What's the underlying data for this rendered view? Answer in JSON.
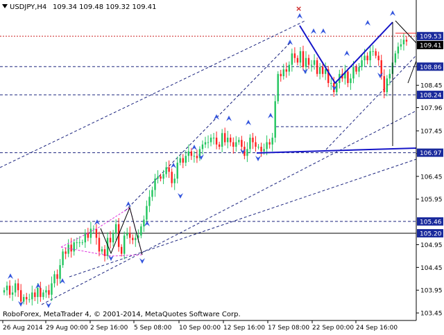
{
  "header": {
    "symbol_timeframe": "USDJPY,H4",
    "ohlc": "109.34 109.48 109.32 109.41",
    "arrow_icon": "triangle-down-icon"
  },
  "watermark": "RoboForex, MetaTrader 4, © 2001-2014, MetaQuotes Software Corp.",
  "colors": {
    "background": "#ffffff",
    "bull": "#22c55e",
    "bear": "#ff2020",
    "level_line": "#1a237e",
    "pattern_line": "#1515c8",
    "fractal": "#3355dd",
    "price_box": "#1a2a9c",
    "current_price": "#000000",
    "top_level": "#cc2222",
    "pattern_pink": "#dd33dd"
  },
  "chart_data": {
    "type": "candlestick",
    "symbol": "USDJPY",
    "timeframe": "H4",
    "ylim": [
      103.3,
      110.05
    ],
    "y_ticks": [
      109.53,
      108.86,
      108.45,
      107.96,
      107.45,
      106.95,
      106.45,
      105.95,
      104.95,
      104.45,
      103.95,
      103.45
    ],
    "y_ticks_text": [
      "109.53",
      "108.86",
      "108.45",
      "107.96",
      "107.45",
      "106.95",
      "106.45",
      "105.95",
      "104.95",
      "104.45",
      "103.95",
      "103.45"
    ],
    "x_labels": [
      "26 Aug 2014",
      "29 Aug 00:00",
      "2 Sep 16:00",
      "5 Sep 08:00",
      "10 Sep 00:00",
      "12 Sep 16:00",
      "17 Sep 08:00",
      "22 Sep 00:00",
      "24 Sep 16:00"
    ],
    "horizontal_levels": [
      {
        "value": 109.53,
        "label": "109.53",
        "style": "dotted-red"
      },
      {
        "value": 108.86,
        "label": "108.86",
        "style": "dashed"
      },
      {
        "value": 108.24,
        "label": "108.24",
        "style": "dashed"
      },
      {
        "value": 106.97,
        "label": "106.97",
        "style": "dashed"
      },
      {
        "value": 105.46,
        "label": "105.46",
        "style": "dashed"
      },
      {
        "value": 105.2,
        "label": "105.20",
        "style": "solid"
      }
    ],
    "current_price": {
      "value": 109.41,
      "label": "109.41"
    },
    "closes": [
      103.95,
      104.05,
      103.85,
      103.9,
      104.1,
      103.95,
      103.7,
      103.8,
      103.75,
      103.75,
      103.9,
      103.8,
      104.0,
      103.8,
      103.9,
      103.95,
      103.85,
      104.1,
      104.3,
      104.2,
      104.5,
      104.8,
      104.75,
      104.95,
      104.8,
      105.0,
      105.0,
      105.0,
      105.0,
      105.2,
      105.1,
      105.3,
      105.3,
      105.1,
      104.8,
      104.85,
      104.7,
      105.1,
      105.0,
      105.2,
      105.4,
      104.9,
      104.75,
      105.15,
      105.2,
      105.1,
      105.05,
      105.1,
      105.15,
      105.35,
      105.5,
      105.8,
      106.0,
      106.15,
      106.4,
      106.45,
      106.4,
      106.5,
      106.65,
      106.55,
      106.3,
      106.4,
      106.75,
      106.85,
      106.75,
      106.9,
      107.0,
      106.9,
      106.9,
      106.85,
      107.05,
      107.15,
      107.2,
      107.2,
      107.3,
      107.3,
      107.15,
      107.1,
      107.4,
      107.2,
      107.3,
      107.2,
      107.1,
      107.2,
      107.25,
      107.1,
      106.9,
      107.05,
      107.3,
      107.2,
      107.1,
      107.1,
      107.0,
      107.05,
      107.2,
      107.15,
      107.3,
      108.1,
      108.7,
      108.65,
      108.8,
      108.75,
      108.9,
      109.15,
      109.05,
      108.95,
      109.2,
      108.85,
      109.05,
      108.9,
      108.9,
      109.0,
      108.7,
      108.85,
      108.7,
      108.8,
      108.5,
      108.5,
      108.3,
      108.5,
      108.7,
      108.6,
      108.75,
      108.5,
      108.6,
      108.85,
      108.75,
      108.85,
      109.0,
      109.1,
      109.0,
      109.2,
      109.2,
      109.1,
      109.0,
      108.65,
      108.3,
      108.6,
      108.7,
      108.95,
      109.15,
      109.3,
      109.35,
      109.45,
      109.41
    ]
  }
}
